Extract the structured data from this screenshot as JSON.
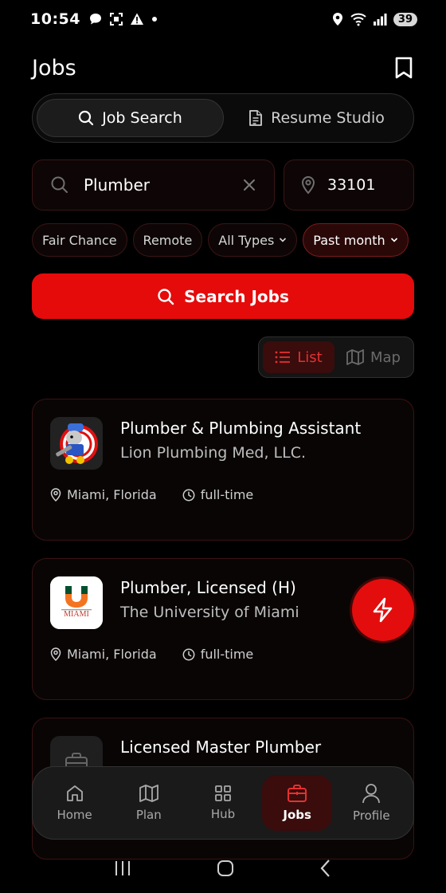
{
  "status_bar": {
    "time": "10:54",
    "battery": "39",
    "left_icons": [
      "chat-bubble-icon",
      "screenshot-icon",
      "warning-icon",
      "dot-icon"
    ],
    "right_icons": [
      "location-icon",
      "wifi-icon",
      "signal-icon"
    ]
  },
  "header": {
    "title": "Jobs",
    "bookmark_icon": "bookmark-icon"
  },
  "mode_tabs": [
    {
      "label": "Job Search",
      "icon": "search-icon",
      "active": true
    },
    {
      "label": "Resume Studio",
      "icon": "document-icon",
      "active": false
    }
  ],
  "search": {
    "keyword_value": "Plumber",
    "zip_value": "33101"
  },
  "filters": [
    {
      "label": "Fair Chance",
      "has_dropdown": false,
      "selected": false
    },
    {
      "label": "Remote",
      "has_dropdown": false,
      "selected": false
    },
    {
      "label": "All Types",
      "has_dropdown": true,
      "selected": false
    },
    {
      "label": "Past month",
      "has_dropdown": true,
      "selected": true
    }
  ],
  "search_button": {
    "label": "Search Jobs"
  },
  "view_toggle": [
    {
      "label": "List",
      "icon": "list-icon",
      "active": true
    },
    {
      "label": "Map",
      "icon": "map-icon",
      "active": false
    }
  ],
  "jobs": [
    {
      "title": "Plumber & Plumbing Assistant",
      "company": "Lion Plumbing Med, LLC.",
      "location": "Miami, Florida",
      "type": "full-time",
      "logo": "plumber-mascot-logo"
    },
    {
      "title": "Plumber, Licensed (H)",
      "company": "The University of Miami",
      "location": "Miami, Florida",
      "type": "full-time",
      "logo": "university-of-miami-logo",
      "logo_text": "MIAMI"
    },
    {
      "title": "Licensed Master Plumber",
      "company": "",
      "location": "",
      "type": "",
      "logo": "briefcase-placeholder-logo"
    }
  ],
  "fab": {
    "icon": "lightning-icon"
  },
  "bottom_nav": [
    {
      "label": "Home",
      "icon": "home-icon",
      "active": false
    },
    {
      "label": "Plan",
      "icon": "map-fold-icon",
      "active": false
    },
    {
      "label": "Hub",
      "icon": "grid-icon",
      "active": false
    },
    {
      "label": "Jobs",
      "icon": "briefcase-icon",
      "active": true
    },
    {
      "label": "Profile",
      "icon": "person-icon",
      "active": false
    }
  ],
  "colors": {
    "accent": "#e50b0b",
    "background": "#000000",
    "card_border": "#3a1212",
    "active_tint": "#3a0c0c"
  }
}
